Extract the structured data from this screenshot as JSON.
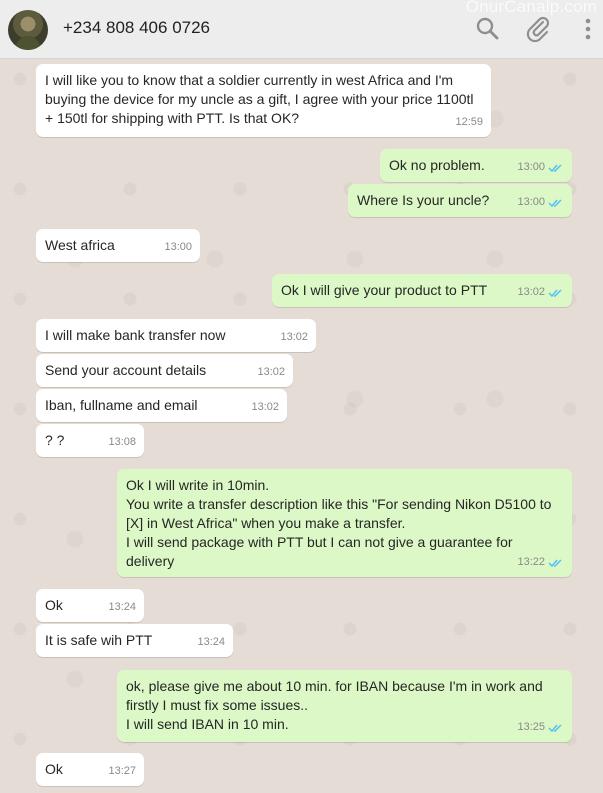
{
  "header": {
    "contact_name": "+234 808 406 0726",
    "watermark": "OnurCanalp.com",
    "icons": [
      "search-icon",
      "attach-icon",
      "menu-icon"
    ]
  },
  "colors": {
    "incoming_bubble": "#ffffff",
    "outgoing_bubble": "#dcf8c6",
    "chat_background": "#e5ddd5",
    "header_background": "#ededed",
    "read_ticks": "#4fc3f7"
  },
  "messages": [
    {
      "direction": "in",
      "text": "I will like you to know that  a soldier currently in west Africa and I'm\nbuying the device for my uncle as a gift, I agree with your price 1100tl\n+ 150tl for shipping with PTT. Is that OK?",
      "time": "12:59"
    },
    {
      "direction": "out",
      "text": "Ok no problem.",
      "time": "13:00",
      "read": true
    },
    {
      "direction": "out",
      "text": "Where Is your uncle?",
      "time": "13:00",
      "read": true
    },
    {
      "direction": "in",
      "text": "West africa",
      "time": "13:00"
    },
    {
      "direction": "out",
      "text": "Ok I will give your product to PTT",
      "time": "13:02",
      "read": true
    },
    {
      "direction": "in",
      "text": "I will make bank transfer now",
      "time": "13:02"
    },
    {
      "direction": "in",
      "text": "Send your account details",
      "time": "13:02"
    },
    {
      "direction": "in",
      "text": "Iban, fullname and email",
      "time": "13:02"
    },
    {
      "direction": "in",
      "text": "? ?",
      "time": "13:08"
    },
    {
      "direction": "out",
      "text": "Ok I will write in 10min.\nYou write a transfer description like this \"For sending Nikon D5100 to\n[X] in West Africa\" when you make a transfer.\nI will send package with PTT but I can not give a guarantee for\ndelivery",
      "time": "13:22",
      "read": true
    },
    {
      "direction": "in",
      "text": "Ok",
      "time": "13:24"
    },
    {
      "direction": "in",
      "text": "It is safe wih PTT",
      "time": "13:24"
    },
    {
      "direction": "out",
      "text": "ok, please give me about 10 min. for IBAN because I'm in work and\nfirstly I must fix some issues..\nI will send IBAN in 10 min.",
      "time": "13:25",
      "read": true
    },
    {
      "direction": "in",
      "text": "Ok",
      "time": "13:27"
    }
  ]
}
